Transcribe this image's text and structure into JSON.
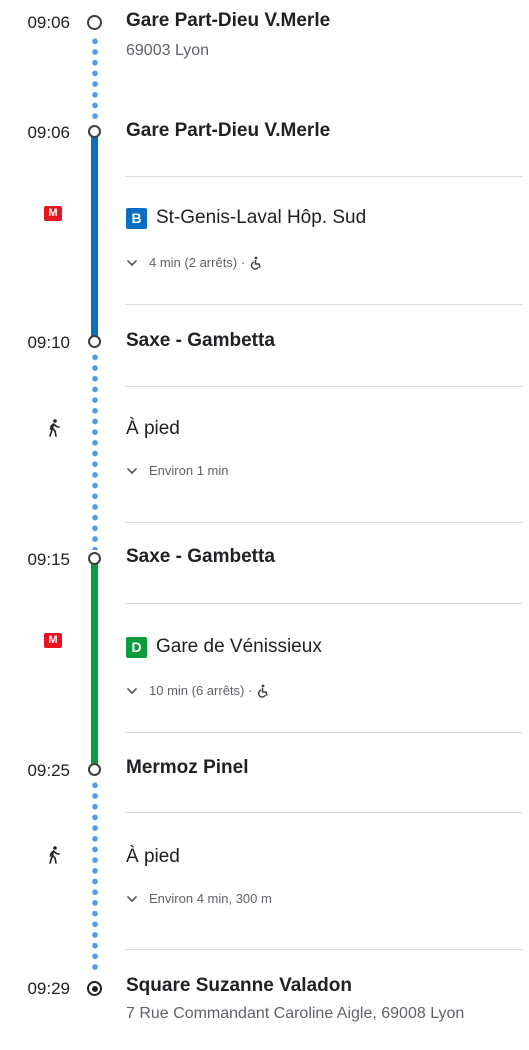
{
  "steps": {
    "start": {
      "time": "09:06",
      "title": "Gare Part-Dieu V.Merle",
      "address": "69003 Lyon"
    },
    "board1": {
      "time": "09:06",
      "title": "Gare Part-Dieu V.Merle"
    },
    "ride1": {
      "mode_icon": "metro-icon",
      "mode_label": "M",
      "line": "B",
      "line_color": "#0a6fc2",
      "destination": "St-Genis-Laval Hôp. Sud",
      "detail": "4 min (2 arrêts) ·"
    },
    "alight1": {
      "time": "09:10",
      "title": "Saxe - Gambetta"
    },
    "walk1": {
      "icon": "walking-icon",
      "label": "À pied",
      "detail": "Environ 1 min"
    },
    "board2": {
      "time": "09:15",
      "title": "Saxe - Gambetta"
    },
    "ride2": {
      "mode_icon": "metro-icon",
      "mode_label": "M",
      "line": "D",
      "line_color": "#0d9b3e",
      "destination": "Gare de Vénissieux",
      "detail": "10 min (6 arrêts) ·"
    },
    "alight2": {
      "time": "09:25",
      "title": "Mermoz Pinel"
    },
    "walk2": {
      "icon": "walking-icon",
      "label": "À pied",
      "detail": "Environ 4 min, 300 m"
    },
    "end": {
      "time": "09:29",
      "title": "Square Suzanne Valadon",
      "address": "7 Rue Commandant Caroline Aigle, 69008 Lyon"
    }
  },
  "colors": {
    "walk_dots": "#4c9cf0",
    "metro_red": "#e8141f"
  }
}
